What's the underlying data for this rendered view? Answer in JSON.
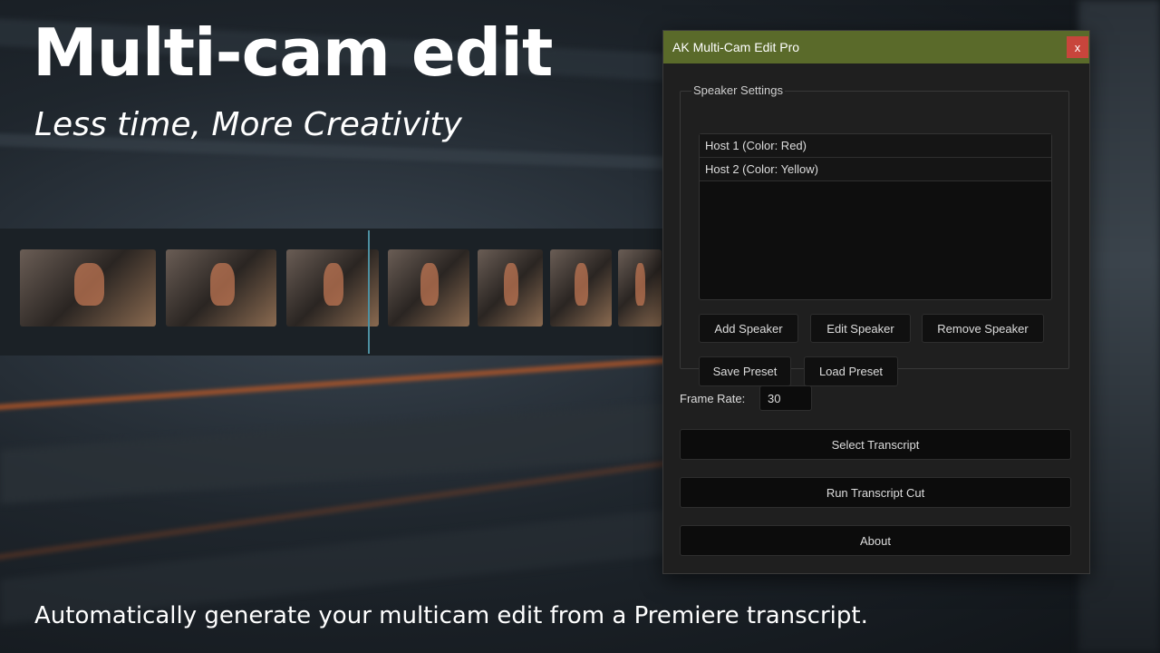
{
  "hero": {
    "title": "Multi-cam edit",
    "subtitle": "Less time, More Creativity",
    "footer": "Automatically generate your multicam edit from a Premiere transcript."
  },
  "window": {
    "title": "AK Multi-Cam Edit Pro",
    "close_label": "x",
    "titlebar_color": "#5a6a2a"
  },
  "speaker_settings": {
    "legend": "Speaker Settings",
    "speakers": [
      {
        "label": "Host 1 (Color: Red)"
      },
      {
        "label": "Host 2 (Color: Yellow)"
      }
    ],
    "buttons": {
      "add": "Add Speaker",
      "edit": "Edit Speaker",
      "remove": "Remove Speaker",
      "save_preset": "Save Preset",
      "load_preset": "Load Preset"
    }
  },
  "frame_rate": {
    "label": "Frame Rate:",
    "value": "30"
  },
  "actions": {
    "select_transcript": "Select Transcript",
    "run_cut": "Run Transcript Cut",
    "about": "About"
  }
}
